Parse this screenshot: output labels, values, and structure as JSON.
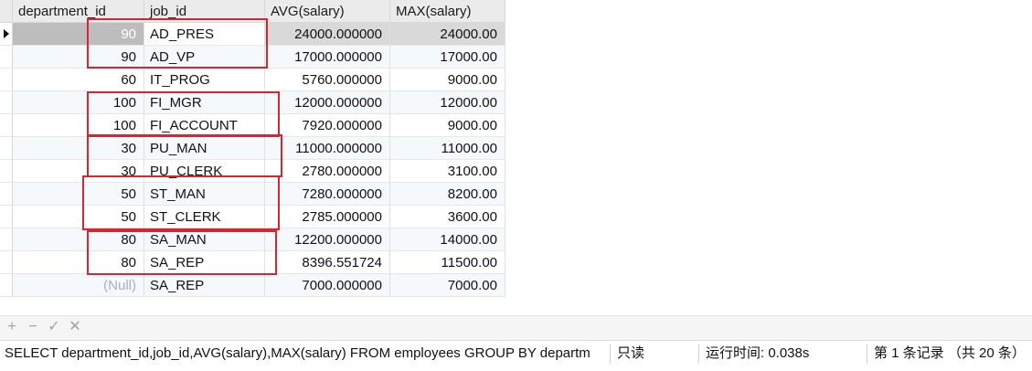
{
  "columns": [
    "department_id",
    "job_id",
    "AVG(salary)",
    "MAX(salary)"
  ],
  "rows": [
    {
      "dept": "90",
      "job": "AD_PRES",
      "avg": "24000.000000",
      "max": "24000.00"
    },
    {
      "dept": "90",
      "job": "AD_VP",
      "avg": "17000.000000",
      "max": "17000.00"
    },
    {
      "dept": "60",
      "job": "IT_PROG",
      "avg": "5760.000000",
      "max": "9000.00"
    },
    {
      "dept": "100",
      "job": "FI_MGR",
      "avg": "12000.000000",
      "max": "12000.00"
    },
    {
      "dept": "100",
      "job": "FI_ACCOUNT",
      "avg": "7920.000000",
      "max": "9000.00"
    },
    {
      "dept": "30",
      "job": "PU_MAN",
      "avg": "11000.000000",
      "max": "11000.00"
    },
    {
      "dept": "30",
      "job": "PU_CLERK",
      "avg": "2780.000000",
      "max": "3100.00"
    },
    {
      "dept": "50",
      "job": "ST_MAN",
      "avg": "7280.000000",
      "max": "8200.00"
    },
    {
      "dept": "50",
      "job": "ST_CLERK",
      "avg": "2785.000000",
      "max": "3600.00"
    },
    {
      "dept": "80",
      "job": "SA_MAN",
      "avg": "12200.000000",
      "max": "14000.00"
    },
    {
      "dept": "80",
      "job": "SA_REP",
      "avg": "8396.551724",
      "max": "11500.00"
    },
    {
      "dept": "(Null)",
      "job": "SA_REP",
      "avg": "7000.000000",
      "max": "7000.00"
    }
  ],
  "toolbar": {
    "add_icon": "plus-icon",
    "delete_icon": "minus-icon",
    "apply_icon": "check-icon",
    "discard_icon": "x-icon",
    "add_glyph": "+",
    "delete_glyph": "−",
    "apply_glyph": "✓",
    "discard_glyph": "✕"
  },
  "status": {
    "sql": "SELECT department_id,job_id,AVG(salary),MAX(salary) FROM employees GROUP BY departm",
    "mode": "只读",
    "runtime": "运行时间: 0.038s",
    "record": "第 1 条记录 （共 20 条）"
  },
  "colors": {
    "highlight_box": "#d6262f",
    "selected_row": "#d9d9d9",
    "header_bg": "#ebebeb",
    "null_text": "#a9a9c8"
  }
}
